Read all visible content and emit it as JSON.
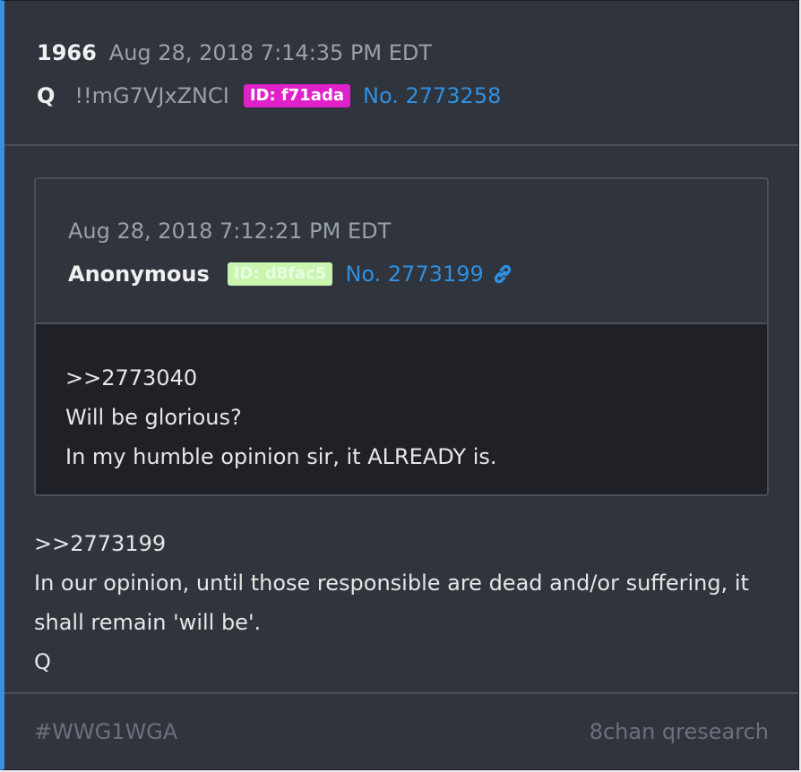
{
  "post": {
    "number": "1966",
    "date": "Aug 28, 2018 7:14:35 PM EDT",
    "author": "Q",
    "tripcode": "!!mG7VJxZNCI",
    "id_badge": "ID: f71ada",
    "post_link": "No. 2773258",
    "body": [
      ">>2773199",
      "In our opinion, until those responsible are dead and/or suffering, it",
      "shall remain 'will be'.",
      "Q"
    ]
  },
  "quoted_post": {
    "date": "Aug 28, 2018 7:12:21 PM EDT",
    "author": "Anonymous",
    "id_badge": "ID: d8fac5",
    "post_link": "No. 2773199",
    "link_icon": "chain-link-icon",
    "body": [
      ">>2773040",
      "Will be glorious?",
      "In my humble opinion sir, it ALREADY is."
    ]
  },
  "footer": {
    "hashtag": "#WWG1WGA",
    "source": "8chan qresearch"
  },
  "colors": {
    "background": "#2f343d",
    "accent_border": "#3a8fe0",
    "link": "#2f8fe0",
    "id_magenta": "#e020c8",
    "id_green": "#c9f5b0",
    "quoted_body_bg": "#1f2126"
  }
}
